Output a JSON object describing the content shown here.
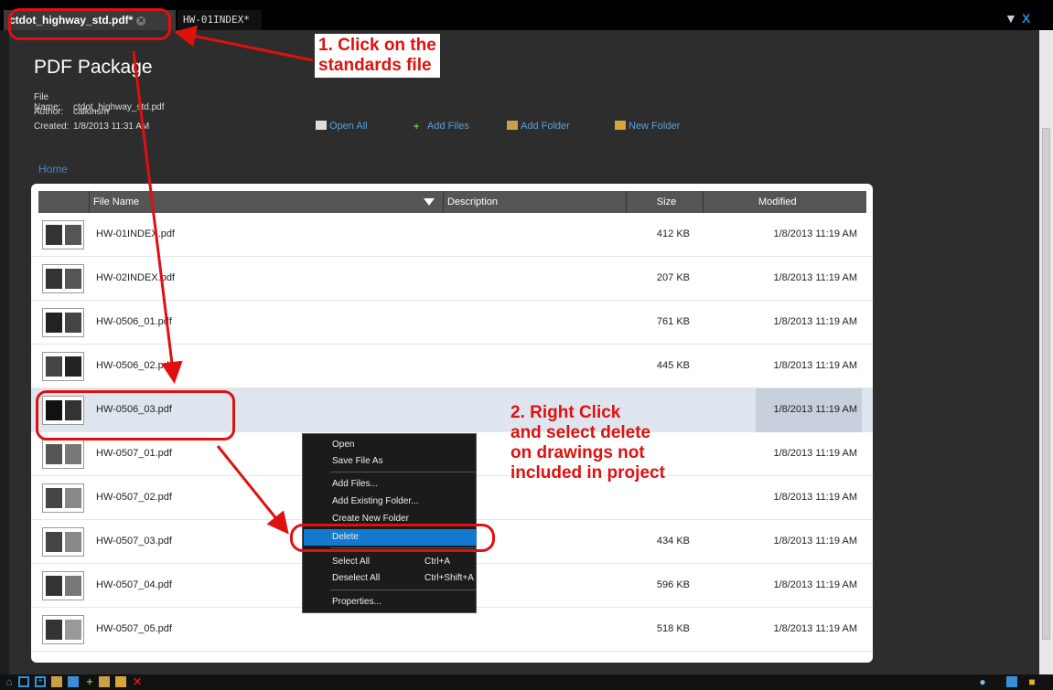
{
  "tabs": [
    {
      "label": "ctdot_highway_std.pdf*",
      "active": true
    },
    {
      "label": "HW-01INDEX*",
      "active": false
    }
  ],
  "package": {
    "title": "PDF Package",
    "file_name_label": "File Name:",
    "file_name": "ctdot_highway_std.pdf",
    "author_label": "Author:",
    "author": "calkinsm",
    "created_label": "Created:",
    "created": "1/8/2013 11:31 AM"
  },
  "actions": {
    "open_all": "Open All",
    "add_files": "Add Files",
    "add_folder": "Add Folder",
    "new_folder": "New Folder"
  },
  "breadcrumb": {
    "home": "Home"
  },
  "columns": {
    "file_name": "File Name",
    "description": "Description",
    "size": "Size",
    "modified": "Modified"
  },
  "files": [
    {
      "name": "HW-01INDEX.pdf",
      "size": "412 KB",
      "modified": "1/8/2013 11:19 AM"
    },
    {
      "name": "HW-02INDEX.pdf",
      "size": "207 KB",
      "modified": "1/8/2013 11:19 AM"
    },
    {
      "name": "HW-0506_01.pdf",
      "size": "761 KB",
      "modified": "1/8/2013 11:19 AM"
    },
    {
      "name": "HW-0506_02.pdf",
      "size": "445 KB",
      "modified": "1/8/2013 11:19 AM"
    },
    {
      "name": "HW-0506_03.pdf",
      "size": "",
      "modified": "1/8/2013 11:19 AM",
      "selected": true
    },
    {
      "name": "HW-0507_01.pdf",
      "size": "",
      "modified": "1/8/2013 11:19 AM"
    },
    {
      "name": "HW-0507_02.pdf",
      "size": "",
      "modified": "1/8/2013 11:19 AM"
    },
    {
      "name": "HW-0507_03.pdf",
      "size": "434 KB",
      "modified": "1/8/2013 11:19 AM"
    },
    {
      "name": "HW-0507_04.pdf",
      "size": "596 KB",
      "modified": "1/8/2013 11:19 AM"
    },
    {
      "name": "HW-0507_05.pdf",
      "size": "518 KB",
      "modified": "1/8/2013 11:19 AM"
    }
  ],
  "context_menu": {
    "open": "Open",
    "save_file_as": "Save File As",
    "add_files": "Add Files...",
    "add_existing_folder": "Add Existing Folder...",
    "create_new_folder": "Create New Folder",
    "delete": "Delete",
    "select_all": "Select All",
    "select_all_shortcut": "Ctrl+A",
    "deselect_all": "Deselect All",
    "deselect_all_shortcut": "Ctrl+Shift+A",
    "properties": "Properties..."
  },
  "annotations": {
    "step1_line1": "1. Click on the",
    "step1_line2": "standards file",
    "step2_line1": "2. Right Click",
    "step2_line2": "and select delete",
    "step2_line3": "on drawings not",
    "step2_line4": "included in project"
  },
  "colors": {
    "annotation": "#e01010",
    "menu_highlight": "#1479cf",
    "link": "#4a87c5"
  },
  "icons": [
    "close-icon",
    "open-all-icon",
    "add-files-icon",
    "add-folder-icon",
    "new-folder-icon",
    "home-icon",
    "collapse-icon",
    "expand-icon",
    "folder-icon",
    "save-icon",
    "add-icon",
    "delete-icon"
  ]
}
